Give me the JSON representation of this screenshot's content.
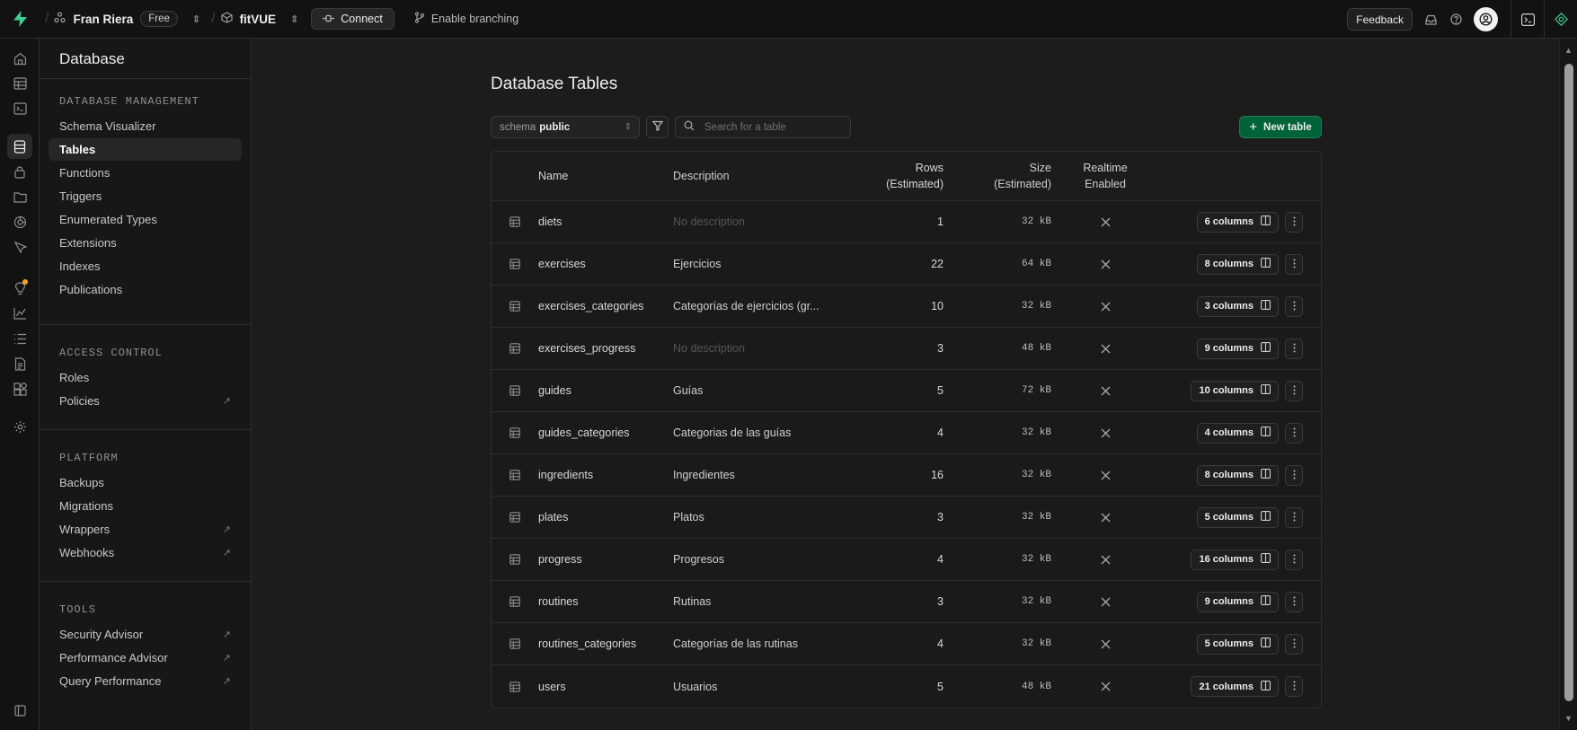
{
  "topbar": {
    "org_name": "Fran Riera",
    "org_plan": "Free",
    "project_name": "fitVUE",
    "connect_label": "Connect",
    "branching_label": "Enable branching",
    "feedback_label": "Feedback"
  },
  "menu": {
    "title": "Database",
    "sections": {
      "database_management": {
        "heading": "DATABASE MANAGEMENT",
        "items": [
          "Schema Visualizer",
          "Tables",
          "Functions",
          "Triggers",
          "Enumerated Types",
          "Extensions",
          "Indexes",
          "Publications"
        ]
      },
      "access_control": {
        "heading": "ACCESS CONTROL",
        "items": [
          "Roles",
          "Policies"
        ]
      },
      "platform": {
        "heading": "PLATFORM",
        "items": [
          "Backups",
          "Migrations",
          "Wrappers",
          "Webhooks"
        ]
      },
      "tools": {
        "heading": "TOOLS",
        "items": [
          "Security Advisor",
          "Performance Advisor",
          "Query Performance"
        ]
      }
    }
  },
  "main": {
    "title": "Database Tables",
    "schema_label": "schema",
    "schema_value": "public",
    "search_placeholder": "Search for a table",
    "new_table_label": "New table",
    "columns": {
      "name": "Name",
      "description": "Description",
      "rows_1": "Rows",
      "rows_2": "(Estimated)",
      "size_1": "Size",
      "size_2": "(Estimated)",
      "realtime_1": "Realtime",
      "realtime_2": "Enabled"
    },
    "tables": [
      {
        "name": "diets",
        "description": "No description",
        "rows": "1",
        "size": "32 kB",
        "columns": "6 columns"
      },
      {
        "name": "exercises",
        "description": "Ejercicios",
        "rows": "22",
        "size": "64 kB",
        "columns": "8 columns"
      },
      {
        "name": "exercises_categories",
        "description": "Categorías de ejercicios (gr...",
        "rows": "10",
        "size": "32 kB",
        "columns": "3 columns"
      },
      {
        "name": "exercises_progress",
        "description": "No description",
        "rows": "3",
        "size": "48 kB",
        "columns": "9 columns"
      },
      {
        "name": "guides",
        "description": "Guías",
        "rows": "5",
        "size": "72 kB",
        "columns": "10 columns"
      },
      {
        "name": "guides_categories",
        "description": "Categorias de las guías",
        "rows": "4",
        "size": "32 kB",
        "columns": "4 columns"
      },
      {
        "name": "ingredients",
        "description": "Ingredientes",
        "rows": "16",
        "size": "32 kB",
        "columns": "8 columns"
      },
      {
        "name": "plates",
        "description": "Platos",
        "rows": "3",
        "size": "32 kB",
        "columns": "5 columns"
      },
      {
        "name": "progress",
        "description": "Progresos",
        "rows": "4",
        "size": "32 kB",
        "columns": "16 columns"
      },
      {
        "name": "routines",
        "description": "Rutinas",
        "rows": "3",
        "size": "32 kB",
        "columns": "9 columns"
      },
      {
        "name": "routines_categories",
        "description": "Categorías de las rutinas",
        "rows": "4",
        "size": "32 kB",
        "columns": "5 columns"
      },
      {
        "name": "users",
        "description": "Usuarios",
        "rows": "5",
        "size": "48 kB",
        "columns": "21 columns"
      }
    ]
  },
  "colors": {
    "accent_green": "#006239",
    "brand_green": "#3ecf8e",
    "notification_dot": "#f5a623"
  },
  "icons": {
    "brand": "supabase-bolt-icon",
    "table_row": "table-icon",
    "realtime_disabled": "x-icon",
    "columns_toggle": "columns-icon",
    "row_menu": "more-vertical-icon"
  }
}
